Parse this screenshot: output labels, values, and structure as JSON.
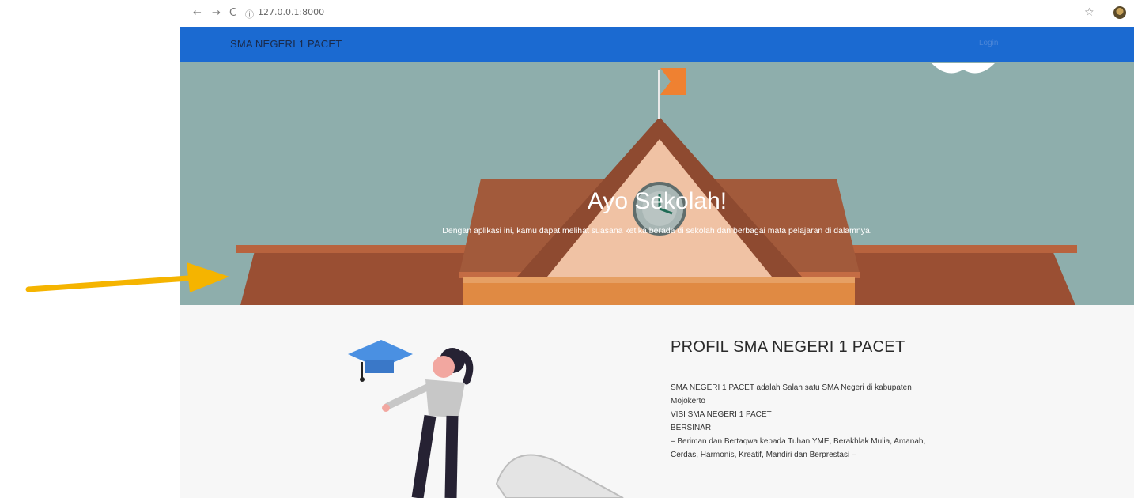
{
  "browser": {
    "back": "←",
    "forward": "→",
    "reload": "C",
    "url": "127.0.0.1:8000",
    "star": "☆"
  },
  "navbar": {
    "brand": "SMA NEGERI 1 PACET",
    "login": "Login"
  },
  "hero": {
    "title": "Ayo Sekolah!",
    "subtitle": "Dengan aplikasi ini, kamu dapat melihat suasana ketika berada di sekolah dan berbagai mata pelajaran di dalamnya."
  },
  "profile": {
    "title": "PROFIL SMA NEGERI 1 PACET",
    "lines": [
      "SMA NEGERI 1 PACET adalah Salah satu SMA Negeri di kabupaten",
      "Mojokerto",
      "VISI SMA NEGERI 1 PACET",
      "BERSINAR",
      "– Beriman dan Bertaqwa kepada Tuhan YME, Berakhlak Mulia, Amanah,",
      "Cerdas, Harmonis, Kreatif, Mandiri dan Berprestasi –"
    ]
  },
  "colors": {
    "navbar": "#1b6ad1",
    "hero_sky": "#8eaeac",
    "roof": "#9a4f33",
    "flag": "#ef8131",
    "arrow": "#f5b400"
  }
}
